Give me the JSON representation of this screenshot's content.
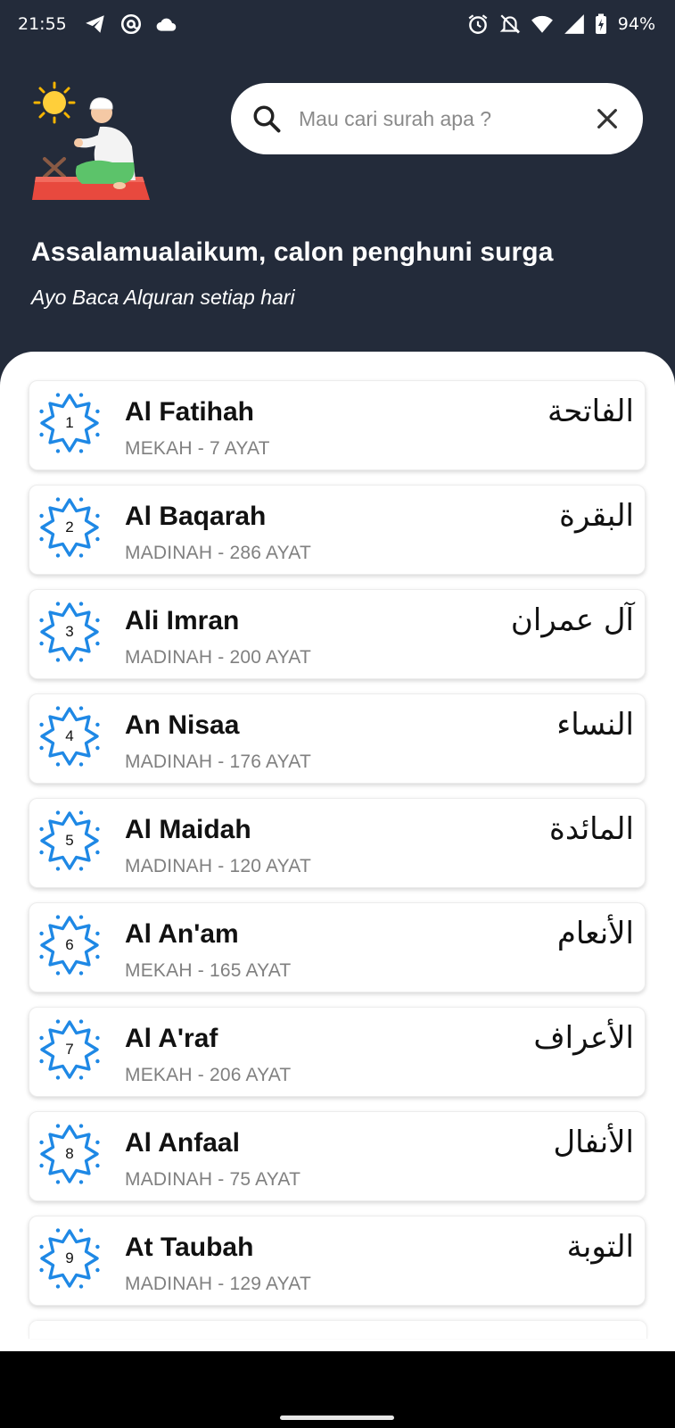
{
  "status_bar": {
    "time": "21:55",
    "battery": "94%",
    "left_icons": [
      "telegram-icon",
      "at-sign-icon",
      "cloud-icon"
    ],
    "right_icons": [
      "alarm-icon",
      "notifications-off-icon",
      "wifi-icon",
      "signal-icon",
      "battery-charging-icon"
    ]
  },
  "header": {
    "greeting": "Assalamualaikum, calon penghuni surga",
    "subgreeting": "Ayo Baca Alquran setiap hari",
    "illustration": "praying-man-illustration"
  },
  "search": {
    "placeholder": "Mau cari surah apa ?",
    "value": ""
  },
  "surahs": [
    {
      "number": "1",
      "name": "Al Fatihah",
      "meta": "MEKAH - 7 AYAT",
      "arabic": "الفاتحة"
    },
    {
      "number": "2",
      "name": "Al Baqarah",
      "meta": "MADINAH - 286 AYAT",
      "arabic": "البقرة"
    },
    {
      "number": "3",
      "name": "Ali Imran",
      "meta": "MADINAH - 200 AYAT",
      "arabic": "آل عمران"
    },
    {
      "number": "4",
      "name": "An Nisaa",
      "meta": "MADINAH - 176 AYAT",
      "arabic": "النساء"
    },
    {
      "number": "5",
      "name": "Al Maidah",
      "meta": "MADINAH - 120 AYAT",
      "arabic": "المائدة"
    },
    {
      "number": "6",
      "name": "Al An'am",
      "meta": "MEKAH - 165 AYAT",
      "arabic": "الأنعام"
    },
    {
      "number": "7",
      "name": "Al A'raf",
      "meta": "MEKAH - 206 AYAT",
      "arabic": "الأعراف"
    },
    {
      "number": "8",
      "name": "Al Anfaal",
      "meta": "MADINAH - 75 AYAT",
      "arabic": "الأنفال"
    },
    {
      "number": "9",
      "name": "At Taubah",
      "meta": "MADINAH - 129 AYAT",
      "arabic": "التوبة"
    }
  ],
  "colors": {
    "header_bg": "#232b3a",
    "badge_blue": "#1e88e5",
    "card_bg": "#ffffff",
    "meta_gray": "#808080"
  }
}
